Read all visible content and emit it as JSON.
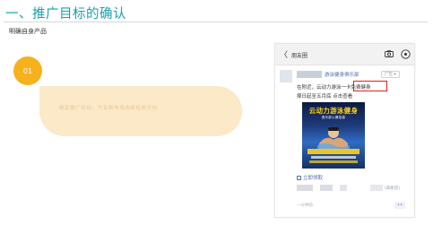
{
  "slide": {
    "title": "一、推广目标的确认",
    "subtitle": "明确自身产品",
    "step_number": "01",
    "step_text": "确定推广目标，为有限市场选择投放方向"
  },
  "phone": {
    "back_symbol": "〈",
    "header_title": "朋友圈",
    "post": {
      "account_name": "游泳健身俱乐部",
      "ad_badge": "广告 ▾",
      "line1": "在附近，云动力游泳一卡免费健身",
      "line2": "择日起至五月底 点击查看",
      "poster_headline": "云动力游泳健身",
      "poster_sub": "俱乐部火爆招募",
      "register_link": "立即领取",
      "location_tag": "(高新店)",
      "time": "一分钟前",
      "more_symbol": "••"
    }
  },
  "colors": {
    "title": "#1aa0a8",
    "circle": "#f6b21d",
    "capsule": "#fbe9c7",
    "highlight_box": "#e02020",
    "link_blue": "#4f6aa1"
  }
}
